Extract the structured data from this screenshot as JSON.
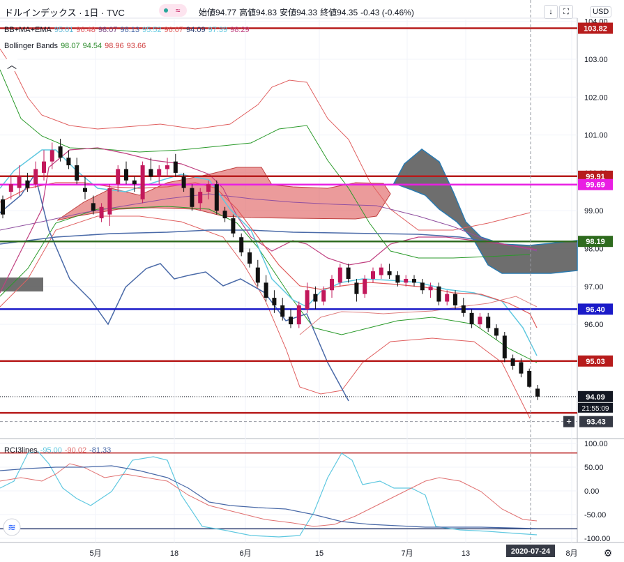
{
  "header": {
    "symbol_title": "ドルインデックス · 1日 · TVC",
    "ohlc": [
      {
        "label": "始値",
        "value": "94.77"
      },
      {
        "label": "高値",
        "value": "94.83"
      },
      {
        "label": "安値",
        "value": "94.33"
      },
      {
        "label": "終値",
        "value": "94.35"
      }
    ],
    "change": "-0.43 (-0.46%)",
    "currency": "USD"
  },
  "indicators": {
    "bb_ma_ema": {
      "name": "BB+MA+EMA",
      "values": [
        {
          "v": "95.01",
          "color": "#5fb8d6"
        },
        {
          "v": "96.48",
          "color": "#e0565d"
        },
        {
          "v": "98.07",
          "color": "#7a4a86"
        },
        {
          "v": "98.13",
          "color": "#4a6aa8"
        },
        {
          "v": "95.52",
          "color": "#5fc8e0"
        },
        {
          "v": "96.07",
          "color": "#e05a5a"
        },
        {
          "v": "94.09",
          "color": "#2c3e70"
        },
        {
          "v": "97.39",
          "color": "#5fc8e0"
        },
        {
          "v": "98.29",
          "color": "#c04080"
        }
      ]
    },
    "bollinger": {
      "name": "Bollinger Bands",
      "values": [
        {
          "v": "98.07",
          "color": "#2a8a2a"
        },
        {
          "v": "94.54",
          "color": "#2a8a2a"
        },
        {
          "v": "98.96",
          "color": "#d04040"
        },
        {
          "v": "93.66",
          "color": "#d04040"
        }
      ]
    },
    "rci": {
      "name": "RCI3lines",
      "values": [
        {
          "v": "-95.00",
          "color": "#5fc8e0"
        },
        {
          "v": "-90.02",
          "color": "#e07070"
        },
        {
          "v": "-81.33",
          "color": "#4a6aa8"
        }
      ]
    }
  },
  "colors": {
    "up_candle": "#c2185b",
    "down_candle": "#111111",
    "cloud_red": "#e06666",
    "cloud_gray": "#555555",
    "hline_red": "#b71c1c",
    "hline_magenta": "#e91ee3",
    "hline_green": "#2e6b1e",
    "hline_blue": "#1a1ac8"
  },
  "price_axis": {
    "ticks": [
      "104.00",
      "103.00",
      "102.00",
      "101.00",
      "100.00",
      "99.00",
      "98.00",
      "97.00",
      "96.00",
      "95.00"
    ],
    "tick_values": [
      104,
      103,
      102,
      101,
      100,
      99,
      98,
      97,
      96,
      95
    ]
  },
  "rci_axis": {
    "ticks": [
      "100.00",
      "50.00",
      "0.00",
      "-50.00",
      "-100.00"
    ],
    "tick_values": [
      100,
      50,
      0,
      -50,
      -100
    ]
  },
  "x_axis": {
    "labels": [
      "5月",
      "18",
      "6月",
      "15",
      "7月",
      "13",
      "8月"
    ],
    "current_date": "2020-07-24"
  },
  "horizontal_lines": [
    {
      "value": 103.82,
      "label": "103.82",
      "color": "#b71c1c"
    },
    {
      "value": 99.91,
      "label": "99.91",
      "color": "#b71c1c"
    },
    {
      "value": 99.69,
      "label": "99.69",
      "color": "#e91ee3"
    },
    {
      "value": 98.19,
      "label": "98.19",
      "color": "#2e6b1e"
    },
    {
      "value": 96.4,
      "label": "96.40",
      "color": "#1a1ac8"
    },
    {
      "value": 95.03,
      "label": "95.03",
      "color": "#b71c1c"
    },
    {
      "value": 93.66,
      "label": "",
      "color": "#b71c1c"
    }
  ],
  "price_badges": {
    "last_price": "94.09",
    "countdown": "21:55:09",
    "cursor_price": "93.43"
  },
  "rci_levels": [
    80,
    -80
  ],
  "chart_data": {
    "type": "candlestick",
    "title": "ドルインデックス · 1日 · TVC",
    "ylim": [
      93,
      104
    ],
    "candles": [
      {
        "o": 99.3,
        "h": 99.4,
        "l": 98.8,
        "c": 98.9
      },
      {
        "o": 99.5,
        "h": 99.9,
        "l": 99.3,
        "c": 99.7
      },
      {
        "o": 99.6,
        "h": 100.2,
        "l": 99.4,
        "c": 99.9
      },
      {
        "o": 99.8,
        "h": 100.0,
        "l": 99.5,
        "c": 99.6
      },
      {
        "o": 99.7,
        "h": 100.3,
        "l": 99.6,
        "c": 100.1
      },
      {
        "o": 100.0,
        "h": 100.6,
        "l": 99.8,
        "c": 100.3
      },
      {
        "o": 100.3,
        "h": 100.8,
        "l": 100.1,
        "c": 100.6
      },
      {
        "o": 100.7,
        "h": 100.9,
        "l": 100.3,
        "c": 100.4
      },
      {
        "o": 100.4,
        "h": 100.6,
        "l": 100.1,
        "c": 100.2
      },
      {
        "o": 100.2,
        "h": 100.4,
        "l": 99.7,
        "c": 99.8
      },
      {
        "o": 99.6,
        "h": 99.9,
        "l": 99.3,
        "c": 99.5
      },
      {
        "o": 99.2,
        "h": 99.4,
        "l": 98.9,
        "c": 99.0
      },
      {
        "o": 98.8,
        "h": 99.2,
        "l": 98.7,
        "c": 99.1
      },
      {
        "o": 98.9,
        "h": 99.7,
        "l": 98.6,
        "c": 99.6
      },
      {
        "o": 99.7,
        "h": 100.2,
        "l": 99.5,
        "c": 100.1
      },
      {
        "o": 100.1,
        "h": 100.3,
        "l": 99.7,
        "c": 99.8
      },
      {
        "o": 99.8,
        "h": 99.9,
        "l": 99.5,
        "c": 99.7
      },
      {
        "o": 99.3,
        "h": 100.3,
        "l": 99.2,
        "c": 100.2
      },
      {
        "o": 100.1,
        "h": 100.4,
        "l": 99.8,
        "c": 99.9
      },
      {
        "o": 99.9,
        "h": 100.2,
        "l": 99.7,
        "c": 100.1
      },
      {
        "o": 100.1,
        "h": 100.4,
        "l": 99.9,
        "c": 100.2
      },
      {
        "o": 100.3,
        "h": 100.5,
        "l": 99.9,
        "c": 100.0
      },
      {
        "o": 99.9,
        "h": 100.0,
        "l": 99.5,
        "c": 99.6
      },
      {
        "o": 99.6,
        "h": 99.7,
        "l": 99.0,
        "c": 99.1
      },
      {
        "o": 99.2,
        "h": 99.6,
        "l": 99.0,
        "c": 99.5
      },
      {
        "o": 99.5,
        "h": 99.8,
        "l": 99.3,
        "c": 99.7
      },
      {
        "o": 99.7,
        "h": 99.8,
        "l": 98.9,
        "c": 99.0
      },
      {
        "o": 99.0,
        "h": 99.1,
        "l": 98.7,
        "c": 98.8
      },
      {
        "o": 98.8,
        "h": 98.9,
        "l": 98.3,
        "c": 98.4
      },
      {
        "o": 98.3,
        "h": 98.4,
        "l": 97.8,
        "c": 97.9
      },
      {
        "o": 97.9,
        "h": 98.0,
        "l": 97.5,
        "c": 97.6
      },
      {
        "o": 97.5,
        "h": 97.7,
        "l": 97.0,
        "c": 97.1
      },
      {
        "o": 97.1,
        "h": 97.3,
        "l": 96.6,
        "c": 96.7
      },
      {
        "o": 96.7,
        "h": 96.9,
        "l": 96.3,
        "c": 96.5
      },
      {
        "o": 96.5,
        "h": 96.7,
        "l": 96.1,
        "c": 96.2
      },
      {
        "o": 96.2,
        "h": 96.4,
        "l": 95.9,
        "c": 96.0
      },
      {
        "o": 96.0,
        "h": 96.6,
        "l": 95.9,
        "c": 96.5
      },
      {
        "o": 96.4,
        "h": 97.1,
        "l": 96.3,
        "c": 96.9
      },
      {
        "o": 96.8,
        "h": 97.0,
        "l": 96.4,
        "c": 96.6
      },
      {
        "o": 96.6,
        "h": 97.0,
        "l": 96.5,
        "c": 96.9
      },
      {
        "o": 96.9,
        "h": 97.3,
        "l": 96.7,
        "c": 97.2
      },
      {
        "o": 97.1,
        "h": 97.6,
        "l": 97.0,
        "c": 97.5
      },
      {
        "o": 97.5,
        "h": 97.6,
        "l": 97.1,
        "c": 97.2
      },
      {
        "o": 97.1,
        "h": 97.2,
        "l": 96.6,
        "c": 96.8
      },
      {
        "o": 96.8,
        "h": 97.3,
        "l": 96.7,
        "c": 97.2
      },
      {
        "o": 97.2,
        "h": 97.5,
        "l": 97.1,
        "c": 97.4
      },
      {
        "o": 97.3,
        "h": 97.6,
        "l": 97.2,
        "c": 97.5
      },
      {
        "o": 97.4,
        "h": 97.6,
        "l": 97.2,
        "c": 97.3
      },
      {
        "o": 97.3,
        "h": 97.4,
        "l": 97.0,
        "c": 97.1
      },
      {
        "o": 97.1,
        "h": 97.3,
        "l": 97.0,
        "c": 97.2
      },
      {
        "o": 97.2,
        "h": 97.3,
        "l": 97.0,
        "c": 97.1
      },
      {
        "o": 97.1,
        "h": 97.2,
        "l": 96.8,
        "c": 96.9
      },
      {
        "o": 96.9,
        "h": 97.1,
        "l": 96.7,
        "c": 97.0
      },
      {
        "o": 97.0,
        "h": 97.1,
        "l": 96.5,
        "c": 96.6
      },
      {
        "o": 96.6,
        "h": 96.9,
        "l": 96.5,
        "c": 96.8
      },
      {
        "o": 96.8,
        "h": 96.9,
        "l": 96.4,
        "c": 96.5
      },
      {
        "o": 96.5,
        "h": 96.7,
        "l": 96.2,
        "c": 96.3
      },
      {
        "o": 96.3,
        "h": 96.4,
        "l": 95.9,
        "c": 96.0
      },
      {
        "o": 96.0,
        "h": 96.3,
        "l": 95.9,
        "c": 96.2
      },
      {
        "o": 96.2,
        "h": 96.3,
        "l": 95.8,
        "c": 95.9
      },
      {
        "o": 95.9,
        "h": 96.0,
        "l": 95.6,
        "c": 95.7
      },
      {
        "o": 95.7,
        "h": 95.8,
        "l": 95.0,
        "c": 95.1
      },
      {
        "o": 95.1,
        "h": 95.2,
        "l": 94.8,
        "c": 94.9
      },
      {
        "o": 95.0,
        "h": 95.1,
        "l": 94.6,
        "c": 94.7
      },
      {
        "o": 94.77,
        "h": 94.83,
        "l": 94.33,
        "c": 94.35
      },
      {
        "o": 94.3,
        "h": 94.4,
        "l": 94.0,
        "c": 94.09
      }
    ]
  }
}
